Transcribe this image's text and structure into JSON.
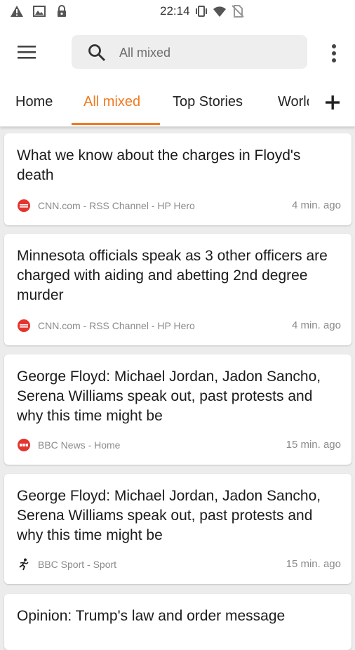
{
  "status_bar": {
    "time": "22:14",
    "left_icons": [
      "warning-icon",
      "image-icon",
      "lock-icon"
    ],
    "right_icons": [
      "vibrate-icon",
      "wifi-icon",
      "no-sim-icon"
    ]
  },
  "toolbar": {
    "search_text": "All mixed"
  },
  "tabs": {
    "items": [
      "Home",
      "All mixed",
      "Top Stories",
      "World"
    ],
    "active": "All mixed",
    "accent_color": "#ef7b22"
  },
  "articles": [
    {
      "title": "What we know about the charges in Floyd's death",
      "source": "CNN.com - RSS Channel - HP Hero",
      "time": "4 min. ago",
      "source_icon": "cnn-logo-icon"
    },
    {
      "title": "Minnesota officials speak as 3 other officers are charged with aiding and abetting 2nd degree murder",
      "source": "CNN.com - RSS Channel - HP Hero",
      "time": "4 min. ago",
      "source_icon": "cnn-logo-icon"
    },
    {
      "title": "George Floyd: Michael Jordan, Jadon Sancho, Serena Williams speak out, past protests and why this time might be",
      "source": "BBC News - Home",
      "time": "15 min. ago",
      "source_icon": "bbc-logo-icon"
    },
    {
      "title": "George Floyd: Michael Jordan, Jadon Sancho, Serena Williams speak out, past protests and why this time might be",
      "source": "BBC Sport - Sport",
      "time": "15 min. ago",
      "source_icon": "running-figure-icon"
    },
    {
      "title": "Opinion: Trump's law and order message",
      "source": "",
      "time": "",
      "source_icon": ""
    }
  ]
}
